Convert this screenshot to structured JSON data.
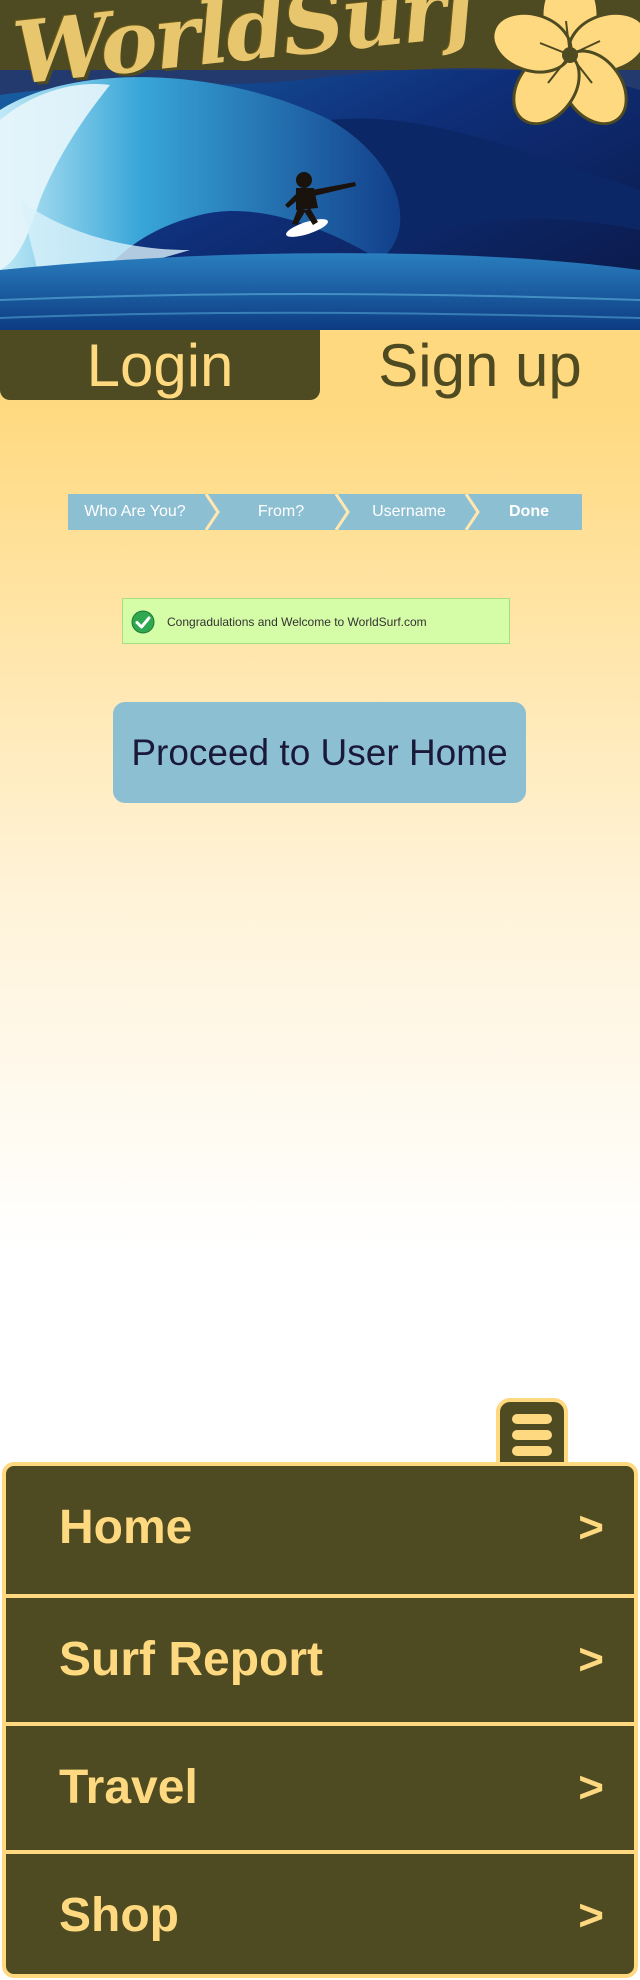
{
  "header": {
    "logo_text": "WorldSurf",
    "hero_image": "surfer riding inside a blue wave barrel",
    "flower_icon": "hibiscus-icon"
  },
  "tabs": {
    "login": "Login",
    "signup": "Sign up"
  },
  "steps": [
    {
      "label": "Who Are You?",
      "active": false
    },
    {
      "label": "From?",
      "active": false
    },
    {
      "label": "Username",
      "active": false
    },
    {
      "label": "Done",
      "active": true
    }
  ],
  "success": {
    "icon": "checkmark-icon",
    "message": "Congradulations and Welcome to WorldSurf.com"
  },
  "proceed_button": "Proceed to User Home",
  "menu": {
    "toggle_icon": "hamburger-menu-icon",
    "items": [
      {
        "label": "Home",
        "arrow": ">"
      },
      {
        "label": "Surf Report",
        "arrow": ">"
      },
      {
        "label": "Travel",
        "arrow": ">"
      },
      {
        "label": "Shop",
        "arrow": ">"
      }
    ]
  },
  "colors": {
    "olive": "#4e4a21",
    "sand": "#ffd97f",
    "sky_blue": "#8dbfd3",
    "success_green": "#d5fca6",
    "dark_text": "#1a1938"
  }
}
